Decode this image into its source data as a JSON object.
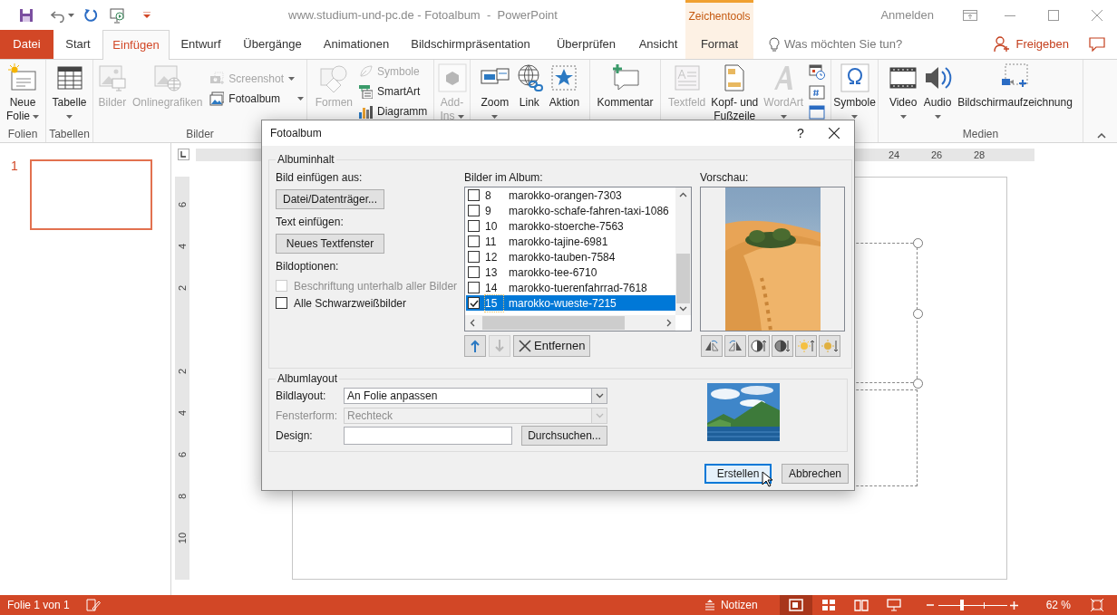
{
  "window": {
    "title": "www.studium-und-pc.de - Fotoalbum  -  PowerPoint",
    "contextual_group": "Zeichentools",
    "account": "Anmelden"
  },
  "tabs": [
    {
      "label": "Datei",
      "kind": "file",
      "selected": false
    },
    {
      "label": "Start",
      "kind": "normal",
      "selected": false
    },
    {
      "label": "Einfügen",
      "kind": "normal",
      "selected": true
    },
    {
      "label": "Entwurf",
      "kind": "normal",
      "selected": false
    },
    {
      "label": "Übergänge",
      "kind": "normal",
      "selected": false
    },
    {
      "label": "Animationen",
      "kind": "normal",
      "selected": false
    },
    {
      "label": "Bildschirmpräsentation",
      "kind": "normal",
      "selected": false
    },
    {
      "label": "Überprüfen",
      "kind": "normal",
      "selected": false
    },
    {
      "label": "Ansicht",
      "kind": "normal",
      "selected": false
    },
    {
      "label": "Format",
      "kind": "contextual",
      "selected": false
    }
  ],
  "tell_me": {
    "placeholder": "Was möchten Sie tun?"
  },
  "share": {
    "label": "Freigeben"
  },
  "ribbon": {
    "groups": [
      {
        "label": "Folien",
        "items": [
          {
            "label": [
              "Neue",
              "Folie"
            ],
            "dropdown": true,
            "disabled": false
          }
        ]
      },
      {
        "label": "Tabellen",
        "items": [
          {
            "label": [
              "Tabelle"
            ],
            "dropdown": true,
            "disabled": false
          }
        ]
      },
      {
        "label": "Bilder",
        "items": [
          {
            "label": [
              "Bilder"
            ],
            "dropdown": false,
            "disabled": true
          },
          {
            "label": [
              "Onlinegrafiken"
            ],
            "dropdown": false,
            "disabled": true
          },
          {
            "label": [
              "Screenshot"
            ],
            "dropdown": true,
            "disabled": true
          },
          {
            "label": [
              "Fotoalbum"
            ],
            "dropdown": true,
            "disabled": false
          }
        ]
      },
      {
        "items": [
          {
            "label": [
              "Formen"
            ],
            "dropdown": false,
            "disabled": true
          },
          {
            "label": [
              "Symbole"
            ],
            "dropdown": false,
            "disabled": true
          },
          {
            "label": [
              "SmartArt"
            ],
            "dropdown": false,
            "disabled": false
          },
          {
            "label": [
              "Diagramm"
            ],
            "dropdown": false,
            "disabled": false
          }
        ]
      },
      {
        "items": [
          {
            "label": [
              "Add-",
              "Ins"
            ],
            "dropdown": true,
            "disabled": true
          }
        ]
      },
      {
        "items": [
          {
            "label": [
              "Zoom"
            ],
            "dropdown": true,
            "disabled": false
          },
          {
            "label": [
              "Link"
            ],
            "dropdown": false,
            "disabled": false
          },
          {
            "label": [
              "Aktion"
            ],
            "dropdown": false,
            "disabled": false
          }
        ]
      },
      {
        "items": [
          {
            "label": [
              "Kommentar"
            ],
            "dropdown": false,
            "disabled": false
          }
        ]
      },
      {
        "items": [
          {
            "label": [
              "Textfeld"
            ],
            "dropdown": false,
            "disabled": true
          },
          {
            "label": [
              "Kopf- und",
              "Fußzeile"
            ],
            "dropdown": false,
            "disabled": false
          },
          {
            "label": [
              "WordArt"
            ],
            "dropdown": true,
            "disabled": true
          }
        ]
      },
      {
        "items": [
          {
            "label": [
              "Symbole"
            ],
            "dropdown": true,
            "disabled": false
          }
        ]
      },
      {
        "label": "Medien",
        "items": [
          {
            "label": [
              "Video"
            ],
            "dropdown": true,
            "disabled": false
          },
          {
            "label": [
              "Audio"
            ],
            "dropdown": true,
            "disabled": false
          },
          {
            "label": [
              "Bildschirmaufzeichnung"
            ],
            "dropdown": false,
            "disabled": false
          }
        ]
      }
    ]
  },
  "slides_pane": {
    "slides": [
      {
        "number": "1",
        "selected": true
      }
    ]
  },
  "rulers": {
    "horizontal": [
      "24",
      "26",
      "28"
    ],
    "vertical": [
      "6",
      "4",
      "2",
      "2",
      "4",
      "6",
      "8",
      "10"
    ]
  },
  "dialog": {
    "title": "Fotoalbum",
    "help": "?",
    "content_section": "Albuminhalt",
    "insert_from": {
      "label": "Bild einfügen aus:",
      "button": "Datei/Datenträger..."
    },
    "insert_text": {
      "label": "Text einfügen:",
      "button": "Neues Textfenster"
    },
    "options_label": "Bildoptionen:",
    "options": [
      {
        "label": "Beschriftung unterhalb aller Bilder",
        "checked": false,
        "disabled": true
      },
      {
        "label": "Alle Schwarzweißbilder",
        "checked": false,
        "disabled": false
      }
    ],
    "album": {
      "label": "Bilder im Album:",
      "pictures": [
        {
          "number": "8",
          "name": "marokko-orangen-7303",
          "checked": false,
          "selected": false
        },
        {
          "number": "9",
          "name": "marokko-schafe-fahren-taxi-1086",
          "checked": false,
          "selected": false
        },
        {
          "number": "10",
          "name": "marokko-stoerche-7563",
          "checked": false,
          "selected": false
        },
        {
          "number": "11",
          "name": "marokko-tajine-6981",
          "checked": false,
          "selected": false
        },
        {
          "number": "12",
          "name": "marokko-tauben-7584",
          "checked": false,
          "selected": false
        },
        {
          "number": "13",
          "name": "marokko-tee-6710",
          "checked": false,
          "selected": false
        },
        {
          "number": "14",
          "name": "marokko-tuerenfahrrad-7618",
          "checked": false,
          "selected": false
        },
        {
          "number": "15",
          "name": "marokko-wueste-7215",
          "checked": true,
          "selected": true
        }
      ],
      "move_buttons": [
        {
          "kind": "up",
          "disabled": false
        },
        {
          "kind": "down",
          "disabled": true
        }
      ],
      "remove": "Entfernen"
    },
    "preview": {
      "label": "Vorschau:"
    },
    "layout_section": "Albumlayout",
    "layout_fields": [
      {
        "label": "Bildlayout:",
        "kind": "select",
        "value": "An Folie anpassen",
        "disabled": false
      },
      {
        "label": "Fensterform:",
        "kind": "select",
        "value": "Rechteck",
        "disabled": true
      },
      {
        "label": "Design:",
        "kind": "text",
        "button": "Durchsuchen..."
      }
    ],
    "buttons": [
      {
        "label": "Erstellen",
        "focused": true
      },
      {
        "label": "Abbrechen",
        "focused": false
      }
    ]
  },
  "status_bar": {
    "slide_info": "Folie 1 von 1",
    "notes": "Notizen",
    "views": [
      {
        "selected": true
      },
      {
        "selected": false
      },
      {
        "selected": false
      },
      {
        "selected": false
      }
    ],
    "zoom": {
      "level": 0.35,
      "reading": "62 %"
    }
  }
}
